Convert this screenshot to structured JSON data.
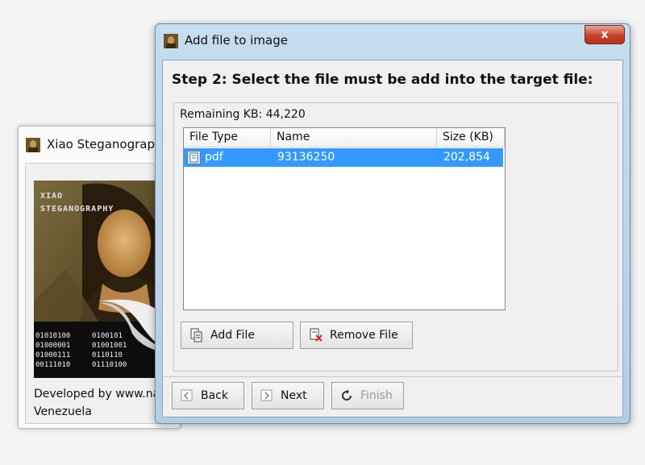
{
  "main_window": {
    "title": "Xiao Steganography",
    "splash": {
      "logo_line1": "XIAO",
      "logo_line2": "STEGANOGRAPHY",
      "binary_col1": [
        "01010100",
        "01000001",
        "01000111",
        "00111010"
      ],
      "binary_col2": [
        "0100101",
        "01001001",
        "0110110",
        "01110100"
      ]
    },
    "credit_line1": "Developed by www.na",
    "credit_line2": "Venezuela"
  },
  "dialog": {
    "title": "Add file to image",
    "close_label": "x",
    "step_heading": "Step 2: Select the file must be add into the target file:",
    "remaining_kb": "Remaining KB: 44,220",
    "table": {
      "columns": [
        "File Type",
        "Name",
        "Size (KB)"
      ],
      "rows": [
        {
          "type": "pdf",
          "name": "93136250",
          "size": "202,854"
        }
      ]
    },
    "buttons": {
      "add_file": "Add File",
      "remove_file": "Remove File",
      "back": "Back",
      "next": "Next",
      "finish": "Finish"
    }
  },
  "colors": {
    "selection": "#3399ff",
    "title_bar": "#c6dcef",
    "close_button": "#c7432e"
  },
  "icons": {
    "dialog_icon": "mona-lisa-app-icon",
    "close": "close-icon",
    "file_row": "pdf-file-icon",
    "add_file": "add-file-icon",
    "remove_file": "remove-file-icon",
    "back": "back-arrow-icon",
    "next": "next-arrow-icon",
    "finish": "refresh-finish-icon"
  }
}
